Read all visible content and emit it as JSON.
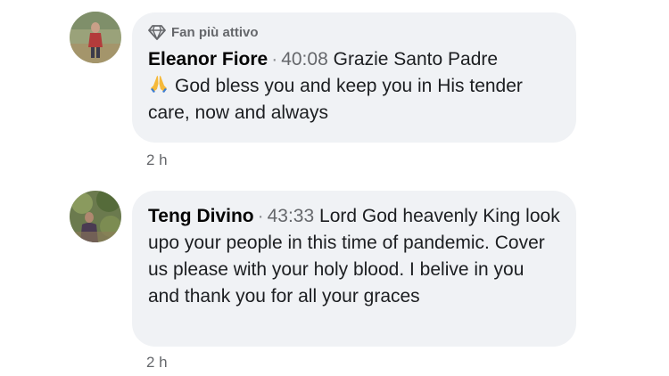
{
  "comments": [
    {
      "badge": "Fan più attivo",
      "author": "Eleanor Fiore",
      "separator": "·",
      "timestamp": "40:08",
      "text_before_emoji": "Grazie Santo Padre",
      "emoji": "folded-hands",
      "text_after_emoji": "God bless you and keep you in His tender care, now and always",
      "age": "2 h"
    },
    {
      "author": "Teng Divino",
      "separator": "·",
      "timestamp": "43:33",
      "text": "Lord God heavenly King look upo your people in this time of pandemic. Cover us please with your holy blood. I belive in you and thank you for all your graces",
      "age": "2 h"
    }
  ],
  "colors": {
    "bubble_bg": "#f0f2f5",
    "secondary_text": "#65676b",
    "primary_text": "#1c1e21"
  },
  "icons": [
    "diamond-badge-icon",
    "folded-hands-emoji"
  ]
}
